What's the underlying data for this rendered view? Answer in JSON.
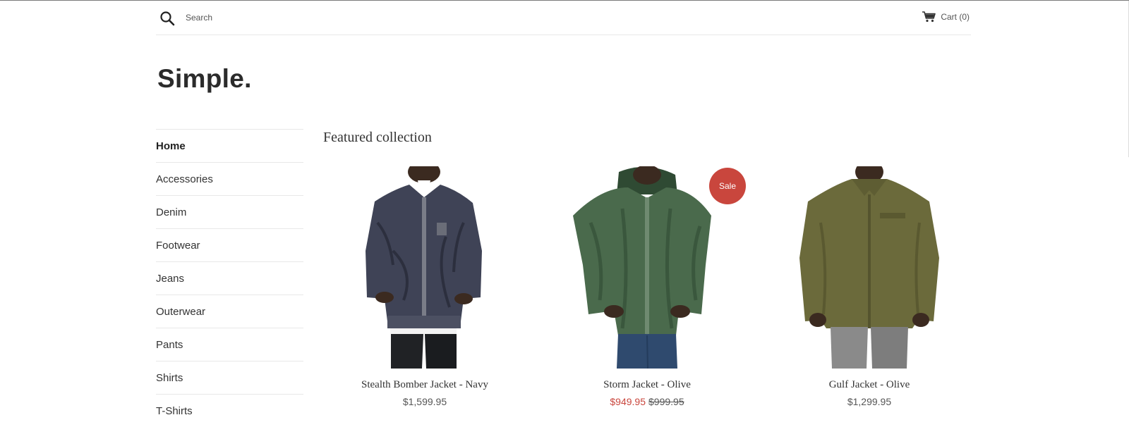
{
  "header": {
    "search_placeholder": "Search",
    "cart_label": "Cart (0)",
    "icons": [
      "search-icon",
      "cart-icon"
    ]
  },
  "logo": "Simple.",
  "sidebar": {
    "items": [
      {
        "label": "Home",
        "active": true
      },
      {
        "label": "Accessories"
      },
      {
        "label": "Denim"
      },
      {
        "label": "Footwear"
      },
      {
        "label": "Jeans"
      },
      {
        "label": "Outerwear"
      },
      {
        "label": "Pants"
      },
      {
        "label": "Shirts"
      },
      {
        "label": "T-Shirts"
      }
    ]
  },
  "main": {
    "section_title": "Featured collection",
    "products": [
      {
        "name": "Stealth Bomber Jacket - Navy",
        "price": "$1,599.95"
      },
      {
        "name": "Storm Jacket - Olive",
        "sale_price": "$949.95",
        "compare_price": "$999.95",
        "badge": "Sale"
      },
      {
        "name": "Gulf Jacket - Olive",
        "price": "$1,299.95"
      }
    ]
  },
  "colors": {
    "accent": "#c9463d",
    "text": "#333333",
    "divider": "#e8e8e8"
  }
}
